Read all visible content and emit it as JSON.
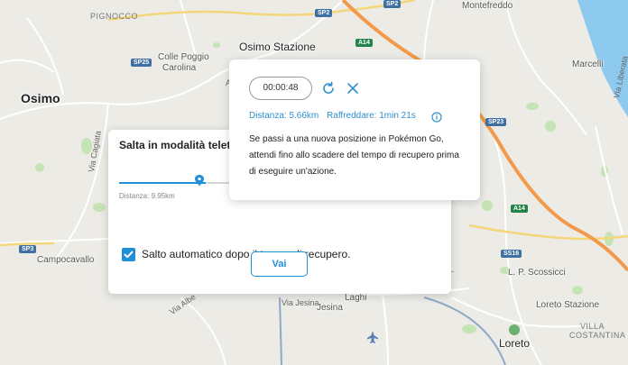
{
  "map": {
    "labels": {
      "pignocco": "PIGNOCCO",
      "osimo_stazione": "Osimo Stazione",
      "colle_poggio": "Colle Poggio",
      "carolina": "Carolina",
      "osimo": "Osimo",
      "montefreddo": "Montefreddo",
      "marcelli": "Marcelli",
      "via_cagiata": "Via Cagiata",
      "campocavallo": "Campocavallo",
      "lp_scossicci": "L. P. Scossicci",
      "laghi": "Laghi",
      "jesina": "Jesina",
      "via_jesina": "Via Jesina",
      "via_albe": "Via Albe",
      "loreto_stazione": "Loreto Stazione",
      "villa": "VILLA",
      "costantina": "COSTANTINA",
      "loreto": "Loreto",
      "via_liberata": "Via Liberata",
      "a": "A",
      "la": "a-"
    },
    "shields": {
      "sp2a": "SP2",
      "sp2b": "SP2",
      "a14a": "A14",
      "a14b": "A14",
      "sp25": "SP25",
      "sp23": "SP23",
      "sp3": "SP3",
      "ss16": "SS16"
    }
  },
  "teleport_modal": {
    "title": "Salta in modalità teletrasporto",
    "distance": "Distanza: 9.95km",
    "auto_jump_label": "Salto automatico dopo il tempo di recupero.",
    "auto_jump_checked": true,
    "go_label": "Vai",
    "slider_fraction": 0.72
  },
  "cooldown_popup": {
    "timer": "00:00:48",
    "distance": "Distanza: 5.66km",
    "cooldown": "Raffreddare: 1min 21s",
    "message": "Se passi a una nuova posizione in Pokémon Go, attendi fino allo scadere del tempo di recupero prima di eseguire un'azione."
  },
  "colors": {
    "accent": "#1f8fd6",
    "highway": "#f2994a",
    "sea": "#8ec9ee",
    "park": "#c5e3b5"
  },
  "icons": {
    "refresh": "refresh-icon",
    "close": "close-icon",
    "info": "info-icon",
    "slider_pin": "map-pin-icon",
    "check": "check-icon",
    "airport": "airplane-icon"
  }
}
